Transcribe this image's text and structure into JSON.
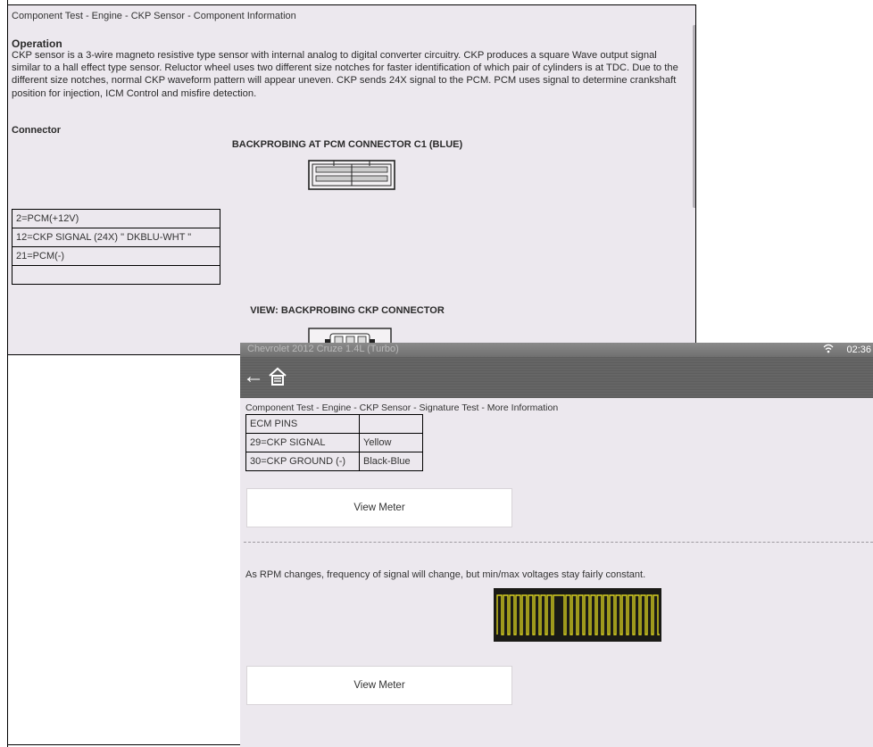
{
  "panel1": {
    "breadcrumb": "Component Test - Engine - CKP Sensor - Component Information",
    "operation_heading": "Operation",
    "operation_text": "CKP sensor is a 3-wire magneto resistive type sensor with internal analog to digital converter circuitry.  CKP produces a square Wave output signal similar to a hall effect type sensor.  Reluctor wheel uses two different size notches for faster identification of which pair of cylinders is at TDC.  Due to the different size notches, normal CKP waveform pattern will appear uneven.  CKP sends 24X signal to the PCM. PCM uses signal to determine crankshaft position for injection, ICM Control and misfire detection.",
    "connector_heading": "Connector",
    "backprobe_title": "BACKPROBING AT PCM CONNECTOR C1 (BLUE)",
    "pin_rows": [
      "2=PCM(+12V)",
      "12=CKP SIGNAL (24X) \" DKBLU-WHT \"",
      "21=PCM(-)",
      ""
    ],
    "view_title": "VIEW: BACKPROBING CKP CONNECTOR"
  },
  "panel2": {
    "status_faded": "Chevrolet 2012 Cruze 1.4L (Turbo)",
    "status_time": "02:36",
    "breadcrumb": "Component Test - Engine - CKP Sensor - Signature Test - More Information",
    "ecm_rows": [
      [
        "ECM PINS",
        ""
      ],
      [
        "29=CKP SIGNAL",
        "Yellow"
      ],
      [
        "30=CKP GROUND (-)",
        "Black-Blue"
      ]
    ],
    "view_meter_1": "View Meter",
    "rpm_note": "As RPM changes, frequency of signal will change, but min/max voltages stay fairly constant.",
    "view_meter_2": "View Meter"
  },
  "icons": {
    "back": "back-arrow-icon",
    "home": "home-icon",
    "wifi": "wifi-icon"
  },
  "colors": {
    "panel_bg": "#ece8ee",
    "navbar": "#636363",
    "waveform": "#d8d020"
  }
}
